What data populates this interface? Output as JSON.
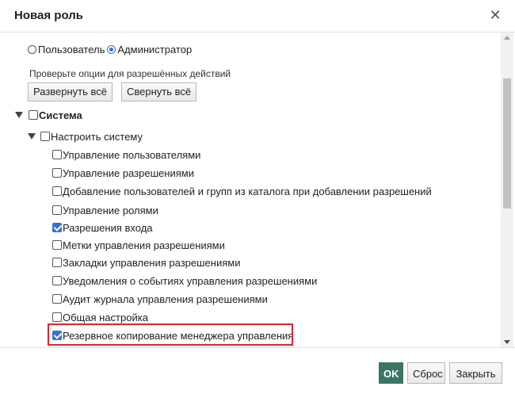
{
  "dialog": {
    "title": "Новая роль",
    "close_symbol": "✕"
  },
  "role_type": {
    "options": [
      {
        "label": "Пользователь",
        "checked": false
      },
      {
        "label": "Администратор",
        "checked": true
      }
    ]
  },
  "permissions": {
    "hint": "Проверьте опции для разрешённых действий",
    "expand_all": "Развернуть всё",
    "collapse_all": "Свернуть всё",
    "root": {
      "label": "Система",
      "checked": false
    },
    "group": {
      "label": "Настроить систему",
      "checked": false
    },
    "items": [
      {
        "label": "Управление пользователями",
        "checked": false
      },
      {
        "label": "Управление разрешениями",
        "checked": false
      },
      {
        "label": "Добавление пользователей и групп из каталога при добавлении разрешений",
        "checked": false
      },
      {
        "label": "Управление ролями",
        "checked": false
      },
      {
        "label": "Разрешения входа",
        "checked": true
      },
      {
        "label": "Метки управления разрешениями",
        "checked": false
      },
      {
        "label": "Закладки управления разрешениями",
        "checked": false
      },
      {
        "label": "Уведомления о событиях управления разрешениями",
        "checked": false
      },
      {
        "label": "Аудит журнала управления разрешениями",
        "checked": false
      },
      {
        "label": "Общая настройка",
        "checked": false
      },
      {
        "label": "Резервное копирование менеджера управления",
        "checked": true
      }
    ]
  },
  "footer": {
    "ok": "OK",
    "reset": "Сброс",
    "close": "Закрыть"
  },
  "colors": {
    "accent": "#3a70d4",
    "ok_button": "#3c7566",
    "highlight_border": "#d9272e"
  }
}
